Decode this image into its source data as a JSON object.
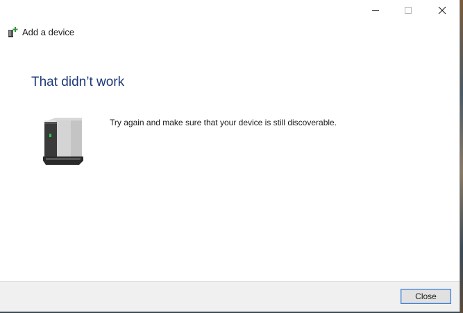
{
  "window": {
    "title": "Add a device",
    "caption_buttons": [
      "minimize-icon",
      "maximize-icon",
      "close-icon"
    ]
  },
  "content": {
    "heading": "That didn’t work",
    "message": "Try again and make sure that your device is still discoverable.",
    "device_icon": "device-tower-icon"
  },
  "footer": {
    "close_label": "Close"
  },
  "colors": {
    "heading": "#1f3a7a",
    "footer_bg": "#f0f0f0",
    "button_border": "#4a7ec8",
    "status_led": "#22cc44"
  }
}
